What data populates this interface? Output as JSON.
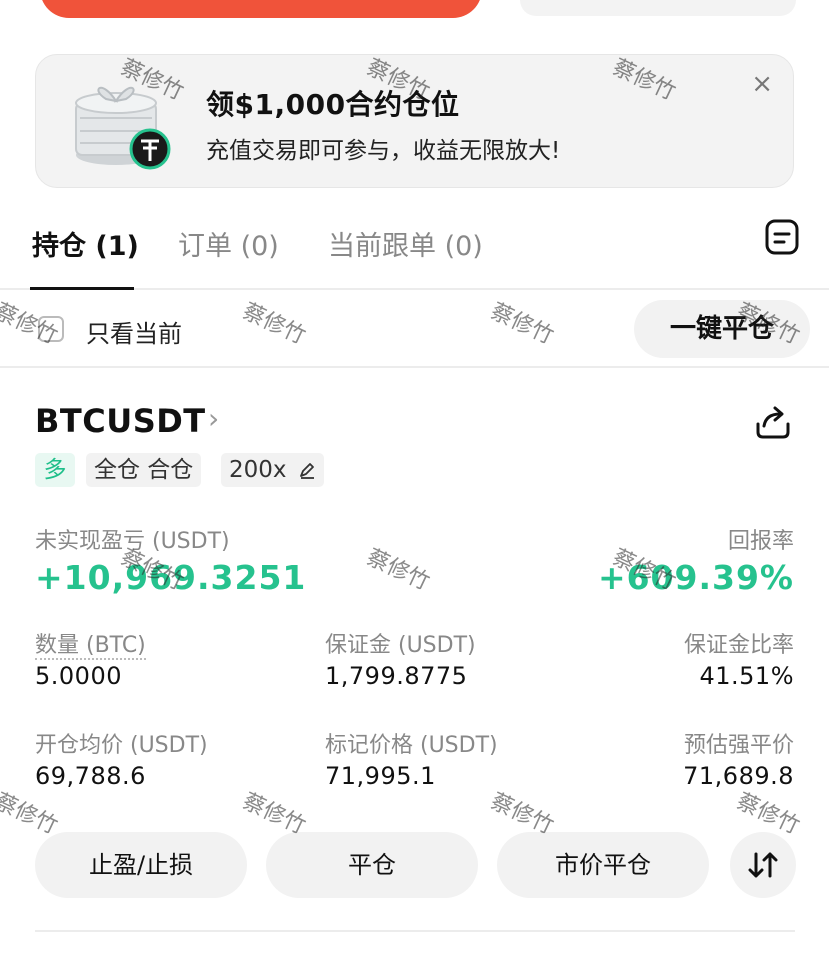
{
  "promo": {
    "title": "领$1,000合约仓位",
    "subtitle": "充值交易即可参与，收益无限放大!",
    "close": "×"
  },
  "tabs": [
    {
      "label": "持仓 (1)",
      "active": true
    },
    {
      "label": "订单 (0)",
      "active": false
    },
    {
      "label": "当前跟单 (0)",
      "active": false
    }
  ],
  "filter": {
    "only_current": "只看当前",
    "close_all": "一键平仓"
  },
  "position": {
    "symbol": "BTCUSDT",
    "chevron": "›",
    "side": "多",
    "margin_mode": "全仓 合仓",
    "leverage": "200x",
    "unrealized_label": "未实现盈亏 (USDT)",
    "unrealized_value": "+10,969.3251",
    "roe_label": "回报率",
    "roe_value": "+609.39%",
    "qty_label": "数量 (BTC)",
    "qty_value": "5.0000",
    "margin_label": "保证金 (USDT)",
    "margin_value": "1,799.8775",
    "margin_ratio_label": "保证金比率",
    "margin_ratio_value": "41.51%",
    "entry_label": "开仓均价 (USDT)",
    "entry_value": "69,788.6",
    "mark_label": "标记价格 (USDT)",
    "mark_value": "71,995.1",
    "liq_label": "预估强平价",
    "liq_value": "71,689.8"
  },
  "actions": {
    "tp_sl": "止盈/止损",
    "close": "平仓",
    "market_close": "市价平仓"
  },
  "watermark": "蔡修竹",
  "colors": {
    "accent_green": "#26c28e",
    "brand_red": "#f0533a"
  }
}
